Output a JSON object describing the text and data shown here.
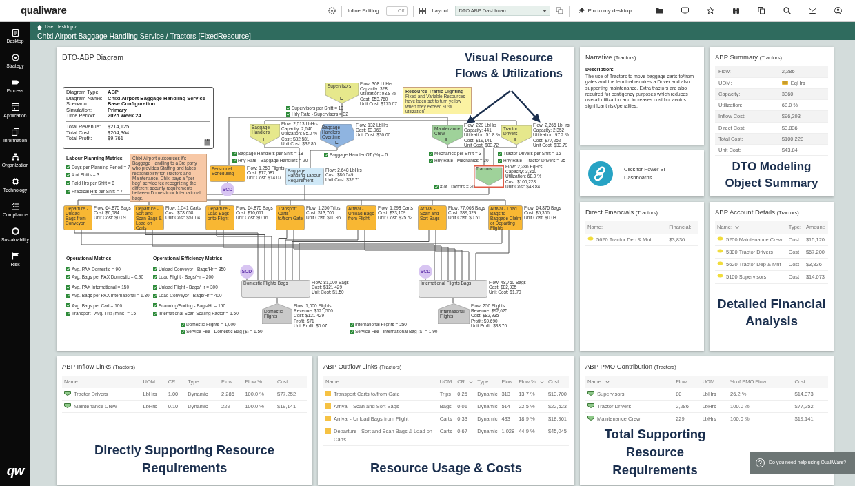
{
  "topbar": {
    "logo": "qualiware",
    "inline_editing_label": "Inline Editing:",
    "inline_editing": {
      "text": "Off",
      "on": false
    },
    "layout_label": "Layout:",
    "layout_value": "DTO ABP Dashboard",
    "pin_label": "Pin to my desktop"
  },
  "sidebar": {
    "items": [
      {
        "label": "Desktop"
      },
      {
        "label": "Strategy"
      },
      {
        "label": "Process"
      },
      {
        "label": "Application"
      },
      {
        "label": "Information"
      },
      {
        "label": "Organization"
      },
      {
        "label": "Technology"
      },
      {
        "label": "Compliance"
      },
      {
        "label": "Sustainability"
      },
      {
        "label": "Risk"
      }
    ],
    "logo": "qw"
  },
  "header": {
    "breadcrumb": "User desktop ›",
    "title": "Chixi Airport Baggage Handling Service / Tractors [FixedResource]"
  },
  "diagram": {
    "title": "DTO-ABP Diagram",
    "info": {
      "rows": [
        {
          "label": "Diagram Type:",
          "value": "ABP"
        },
        {
          "label": "Diagram Name:",
          "value": "Chixi Airport Baggage Handling Service"
        },
        {
          "label": "Scenario:",
          "value": "Base Configuration"
        },
        {
          "label": "Simulation:",
          "value": "Primary"
        },
        {
          "label": "Time Period:",
          "value": "2025 Week 24"
        }
      ],
      "totals": [
        {
          "label": "Total Revenue:",
          "value": "$214,125"
        },
        {
          "label": "Total Cost:",
          "value": "$204,364"
        },
        {
          "label": "Total Profit:",
          "value": "$9,761"
        }
      ]
    },
    "metric_groups": [
      {
        "title": "Labour Planning Metrics",
        "items": [
          "Days per Planning Period = 7",
          "# of Shifts = 3",
          "Paid Hrs per Shift = 8",
          "Practical Hrs per Shift = 7"
        ]
      },
      {
        "title": "Operational Metrics",
        "items": [
          "Avg. PAX Domestic = 90",
          "Avg. Bags per PAX Domestic = 0.90",
          "Avg. PAX International = 150",
          "Avg. Bags per PAX International = 1.30",
          "Avg. Bags per Cart = 100",
          "Transport - Avg. Trip (mins) = 15"
        ]
      },
      {
        "title": "Operational Efficiency Metrics",
        "items": [
          "Unload Conveyor - Bags/Hr = 350",
          "Load Flight - Bags/Hr = 200",
          "Unload Flight - Bags/Hr = 300",
          "Load Conveyor - Bags/Hr = 400",
          "Scanning/Sorting - Bags/Hr = 150",
          "International Scan Scaling Factor = 1.50"
        ]
      }
    ],
    "notes": [
      {
        "text": "Chixi Airport outsources it's Baggage Handling to a 3rd party who provides Staffing and takes responsibility for Tractors and Maintenance. Chixi pays a \"per bag\" service fee recognizing the different security requirements between Domestic or International bags.",
        "color": "#f7c8a6"
      },
      {
        "title": "Resource Traffic Lighting",
        "text": "Fixed and Variable Resources have been set to turn yellow when they exceed 90% utilization",
        "color": "#fbf2a2"
      }
    ],
    "parameters": [
      "Supervisors per Shift = 10",
      "Hrly Rate - Supervisors = 32",
      "Baggage Handlers per Shift = 18",
      "Hrly Rate - Baggage Handlers = 20",
      "Baggage Handler OT (%) = 5",
      "Mechanics per Shift = 3",
      "Hrly Rate - Mechanics = 30",
      "Tractor Drivers per Shift = 16",
      "Hrly Rate - Tractor Drivers = 25",
      "# of Tractors = 20",
      "Domestic Flights = 1,000",
      "Service Fee - Domestic Bag ($) = 1.50",
      "International Flights = 250",
      "Service Fee - International Bag ($) = 1.90"
    ],
    "nodes": [
      {
        "name": "Supervisors",
        "kind": "pentagon",
        "color": "#e6e88c",
        "marker": "L",
        "selected": false,
        "stats": [
          "Flow: 308 LbHrs",
          "Capacity: 328",
          "Utilization: 93.8 %",
          "Cost: $53,760",
          "Unit Cost: $175.67"
        ]
      },
      {
        "name": "Baggage Handlers",
        "kind": "pentagon",
        "color": "#e6e88c",
        "marker": "L",
        "selected": false,
        "stats": [
          "Flow: 2,513 LbHrs",
          "Capacity: 2,646",
          "Utilization: 95.0 %",
          "Cost: $82,581",
          "Unit Cost: $32.86"
        ]
      },
      {
        "name": "Baggage Handlers Overtime",
        "kind": "hexagon",
        "color": "#8fb4e0",
        "marker": "L",
        "selected": false,
        "stats": [
          "Flow: 132 LbHrs",
          "Cost: $3,969",
          "Unit Cost: $30.00"
        ]
      },
      {
        "name": "Maintenance Crew",
        "kind": "pentagon",
        "color": "#9fd29a",
        "marker": "L",
        "selected": false,
        "stats": [
          "Flow: 229 LbHrs",
          "Capacity: 441",
          "Utilization: 51.8 %",
          "Cost: $19,141",
          "Unit Cost: $83.72"
        ]
      },
      {
        "name": "Tractor Drivers",
        "kind": "pentagon",
        "color": "#e6e88c",
        "marker": "L",
        "selected": false,
        "stats": [
          "Flow: 2,266 LbHrs",
          "Capacity: 2,352",
          "Utilization: 97.2 %",
          "Cost: $77,252",
          "Unit Cost: $33.79"
        ]
      },
      {
        "name": "Personnel Scheduling",
        "kind": "box",
        "color": "#f8b733",
        "selected": false,
        "stats": [
          "Flow: 1,250 Flights",
          "Cost: $17,587",
          "Unit Cost: $14.07"
        ]
      },
      {
        "name": "Baggage Handling Labour Requirement",
        "kind": "box",
        "color": "#cfe8f7",
        "selected": false,
        "stats": [
          "Flow: 2,648 LbHrs",
          "Cost: $86,549",
          "Unit Cost: $32.71"
        ]
      },
      {
        "name": "Tractors",
        "kind": "pentagon",
        "color": "#9fd29a",
        "selected": true,
        "stats": [
          "Flow: 2,286 EqHrs",
          "Capacity: 3,360",
          "Utilization: 68.0 %",
          "Cost: $100,228",
          "Unit Cost: $43.84"
        ]
      },
      {
        "name": "Departure - Unload Bags from Conveyor",
        "kind": "box",
        "color": "#f8b733",
        "selected": false,
        "stats": [
          "Flow: 64,875 Bags",
          "Cost: $6,084",
          "Unit Cost: $0.09"
        ]
      },
      {
        "name": "Departure - Sort and Scan Bags & Load on Carts",
        "kind": "box",
        "color": "#f8b733",
        "selected": false,
        "stats": [
          "Flow: 1,541 Carts",
          "Cost: $78,658",
          "Unit Cost: $51.04"
        ]
      },
      {
        "name": "Departure - Load Bags onto Flight",
        "kind": "box",
        "color": "#f8b733",
        "selected": false,
        "stats": [
          "Flow: 64,875 Bags",
          "Cost: $10,611",
          "Unit Cost: $0.16"
        ]
      },
      {
        "name": "Transport Carts to/from Gate",
        "kind": "box",
        "color": "#f8b733",
        "selected": false,
        "stats": [
          "Flow: 1,250 Trips",
          "Cost: $13,700",
          "Unit Cost: $10.96"
        ]
      },
      {
        "name": "Arrival - Unload Bags from Flight",
        "kind": "box",
        "color": "#f8b733",
        "selected": false,
        "stats": [
          "Flow: 1,298 Carts",
          "Cost: $33,109",
          "Unit Cost: $25.52"
        ]
      },
      {
        "name": "Arrival - Scan and Sort Bags",
        "kind": "box",
        "color": "#f8b733",
        "selected": false,
        "stats": [
          "Flow: 77,063 Bags",
          "Cost: $39,329",
          "Unit Cost: $0.51"
        ]
      },
      {
        "name": "Arrival - Load Bags to Baggage Claim or Departing Flights",
        "kind": "box",
        "color": "#f8b733",
        "selected": false,
        "stats": [
          "Flow: 64,875 Bags",
          "Cost: $5,306",
          "Unit Cost: $0.08"
        ]
      },
      {
        "name": "Domestic Flights Bags",
        "kind": "box",
        "color": "#e4e4e4",
        "selected": false,
        "stats": [
          "Flow: 81,000 Bags",
          "Cost: $121,429",
          "Unit Cost: $1.50"
        ]
      },
      {
        "name": "International Flights Bags",
        "kind": "box",
        "color": "#e4e4e4",
        "selected": false,
        "stats": [
          "Flow: 48,750 Bags",
          "Cost: $82,935",
          "Unit Cost: $1.70"
        ]
      },
      {
        "name": "Domestic Flights",
        "kind": "roof",
        "color": "#c9c9c9",
        "selected": false,
        "stats": [
          "Flow: 1,000 Flights",
          "Revenue: $121,500",
          "Cost: $121,429",
          "Profit: $71",
          "Unit Profit: $0.07"
        ]
      },
      {
        "name": "International Flights",
        "kind": "roof",
        "color": "#c9c9c9",
        "selected": false,
        "stats": [
          "Flow: 250 Flights",
          "Revenue: $92,625",
          "Cost: $82,935",
          "Profit: $9,690",
          "Unit Profit: $38.76"
        ]
      }
    ],
    "badges": [
      "SCD",
      "SCD",
      "SCD"
    ],
    "callout": "Visual Resource Flows & Utilizations"
  },
  "narrative": {
    "title": "Narrative",
    "subtitle": "(Tractors)",
    "heading": "Description:",
    "text": "The use of Tractors to move baggage carts to/from gates and the terminal requires a Driver and also supporting maintenance. Extra tractors are also required for contigency purposes which reduces overall utilization and increases cost but avoids significant risk/penalties."
  },
  "summary": {
    "title": "ABP Summary",
    "subtitle": "(Tractors)",
    "rows": [
      {
        "label": "Flow:",
        "value": "2,286",
        "kind": "text"
      },
      {
        "label": "UOM:",
        "value": "EqHrs",
        "kind": "unit"
      },
      {
        "label": "Capacity:",
        "value": "3360",
        "kind": "text"
      },
      {
        "label": "Utilization:",
        "value": "68.0 %",
        "kind": "text"
      },
      {
        "label": "Inflow Cost:",
        "value": "$96,393",
        "kind": "text"
      },
      {
        "label": "Direct Cost:",
        "value": "$3,836",
        "kind": "text"
      },
      {
        "label": "Total Cost:",
        "value": "$100,228",
        "kind": "text"
      },
      {
        "label": "Unit Cost:",
        "value": "$43.84",
        "kind": "text"
      }
    ],
    "callout": "DTO Modeling Object Summary"
  },
  "power_bi": {
    "text": "Click for Power BI Dashboards"
  },
  "direct_financials": {
    "title": "Direct Financials",
    "subtitle": "(Tractors)",
    "kind": "account",
    "columns": [
      {
        "label": "Name:",
        "caret": false
      },
      {
        "label": "Financial:",
        "caret": false
      }
    ],
    "rows": [
      [
        "5620 Tractor Dep & Mnt",
        "$3,836"
      ]
    ]
  },
  "account_details": {
    "title": "ABP Account Details",
    "subtitle": "(Tractors)",
    "kind": "account",
    "columns": [
      {
        "label": "Name:",
        "caret": true
      },
      {
        "label": "Type:",
        "caret": false
      },
      {
        "label": "Amount:",
        "caret": false
      }
    ],
    "rows": [
      [
        "5200 Maintenance Crew",
        "Cost",
        "$15,120"
      ],
      [
        "5300 Tractor Drivers",
        "Cost",
        "$67,200"
      ],
      [
        "5620 Tractor Dep & Mnt",
        "Cost",
        "$3,836"
      ],
      [
        "5100 Supervisors",
        "Cost",
        "$14,073"
      ]
    ],
    "callout": "Detailed Financial Analysis"
  },
  "inflow_links": {
    "title": "ABP Inflow Links",
    "subtitle": "(Tractors)",
    "kind": "resource",
    "columns": [
      {
        "label": "Name:",
        "caret": false
      },
      {
        "label": "UOM:",
        "caret": false
      },
      {
        "label": "CR:",
        "caret": false
      },
      {
        "label": "Type:",
        "caret": false
      },
      {
        "label": "Flow:",
        "caret": false
      },
      {
        "label": "Flow %:",
        "caret": false
      },
      {
        "label": "Cost:",
        "caret": false
      }
    ],
    "rows": [
      [
        "Tractor Drivers",
        "LbHrs",
        "1.00",
        "Dynamic",
        "2,286",
        "100.0 %",
        "$77,252"
      ],
      [
        "Maintenance Crew",
        "LbHrs",
        "0.10",
        "Dynamic",
        "229",
        "100.0 %",
        "$19,141"
      ]
    ],
    "callout": "Directly Supporting Resource Requirements"
  },
  "outflow_links": {
    "title": "ABP Outflow Links",
    "subtitle": "(Tractors)",
    "kind": "activity",
    "columns": [
      {
        "label": "Name:",
        "caret": false
      },
      {
        "label": "UOM:",
        "caret": false
      },
      {
        "label": "CR:",
        "caret": true
      },
      {
        "label": "Type:",
        "caret": false
      },
      {
        "label": "Flow:",
        "caret": false
      },
      {
        "label": "Flow %:",
        "caret": true
      },
      {
        "label": "Cost:",
        "caret": false
      }
    ],
    "rows": [
      [
        "Transport Carts to/from Gate",
        "Trips",
        "0.25",
        "Dynamic",
        "313",
        "13.7 %",
        "$13,700"
      ],
      [
        "Arrival - Scan and Sort Bags",
        "Bags",
        "0.01",
        "Dynamic",
        "514",
        "22.5 %",
        "$22,523"
      ],
      [
        "Arrival - Unload Bags from Flight",
        "Carts",
        "0.33",
        "Dynamic",
        "433",
        "18.9 %",
        "$18,961"
      ],
      [
        "Departure - Sort and Scan Bags & Load on Carts",
        "Carts",
        "0.67",
        "Dynamic",
        "1,028",
        "44.9 %",
        "$45,045"
      ]
    ],
    "callout": "Resource Usage & Costs"
  },
  "pmo_contribution": {
    "title": "ABP PMO Contribution",
    "subtitle": "(Tractors)",
    "kind": "resource",
    "columns": [
      {
        "label": "Name:",
        "caret": true
      },
      {
        "label": "Flow:",
        "caret": false
      },
      {
        "label": "UOM:",
        "caret": false
      },
      {
        "label": "% of PMO Flow:",
        "caret": false
      },
      {
        "label": "Cost:",
        "caret": false
      }
    ],
    "rows": [
      [
        "Supervisors",
        "80",
        "LbHrs",
        "26.2 %",
        "$14,073"
      ],
      [
        "Tractor Drivers",
        "2,286",
        "LbHrs",
        "100.0 %",
        "$77,252"
      ],
      [
        "Maintenance Crew",
        "229",
        "LbHrs",
        "100.0 %",
        "$19,141"
      ]
    ],
    "callout": "Total Supporting Resource Requirements"
  },
  "help": {
    "text": "Do you need help using QualiWare?"
  }
}
